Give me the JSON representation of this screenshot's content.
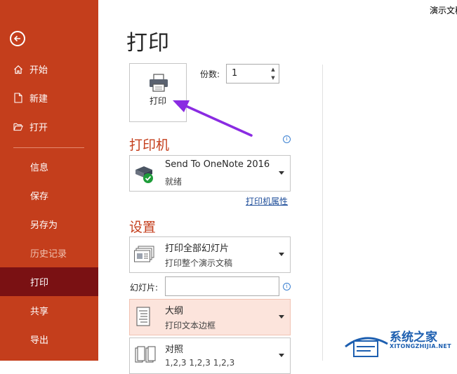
{
  "window_title": "演示文稿",
  "sidebar": {
    "items": [
      {
        "label": "开始"
      },
      {
        "label": "新建"
      },
      {
        "label": "打开"
      },
      {
        "label": "信息"
      },
      {
        "label": "保存"
      },
      {
        "label": "另存为"
      },
      {
        "label": "历史记录"
      },
      {
        "label": "打印"
      },
      {
        "label": "共享"
      },
      {
        "label": "导出"
      }
    ]
  },
  "main": {
    "title": "打印",
    "print_button_label": "打印",
    "copies_label": "份数:",
    "copies_value": "1",
    "printer_section": "打印机",
    "printer": {
      "name": "Send To OneNote 2016",
      "status": "就绪"
    },
    "printer_properties_link": "打印机属性",
    "settings_section": "设置",
    "slides_range": {
      "main": "打印全部幻灯片",
      "sub": "打印整个演示文稿"
    },
    "slides_label": "幻灯片:",
    "slides_value": "",
    "layout": {
      "main": "大纲",
      "sub": "打印文本边框"
    },
    "collation": {
      "main": "对照",
      "sub": "1,2,3   1,2,3   1,2,3"
    }
  },
  "watermark": {
    "title": "系统之家",
    "subtitle": "XITONGZHIJIA.NET"
  },
  "colors": {
    "sidebar_bg": "#c43e1c",
    "sidebar_active": "#7a1113",
    "section_title": "#c43e1c",
    "highlight_bg": "#fce4dc",
    "annotation_arrow": "#8a2be2"
  }
}
